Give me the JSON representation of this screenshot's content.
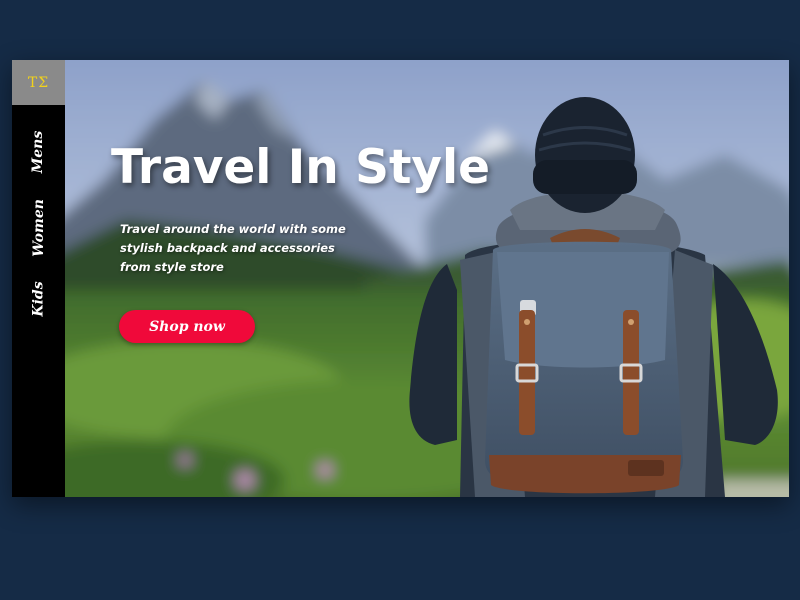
{
  "brand": {
    "logo_text": "TΣ",
    "logo_color": "#f2d21b"
  },
  "sidebar": {
    "items": [
      {
        "label": "Mens"
      },
      {
        "label": "Women"
      },
      {
        "label": "Kids"
      }
    ]
  },
  "hero": {
    "headline": "Travel In Style",
    "subtext": "Travel around the world with some stylish backpack and accessories from style store",
    "cta_label": "Shop now",
    "cta_color": "#f0093a",
    "image": "hiker-with-backpack-mountain-landscape"
  },
  "colors": {
    "page_background": "#152b46",
    "sidebar_background": "#000000",
    "logo_background": "#8a8a8a"
  }
}
